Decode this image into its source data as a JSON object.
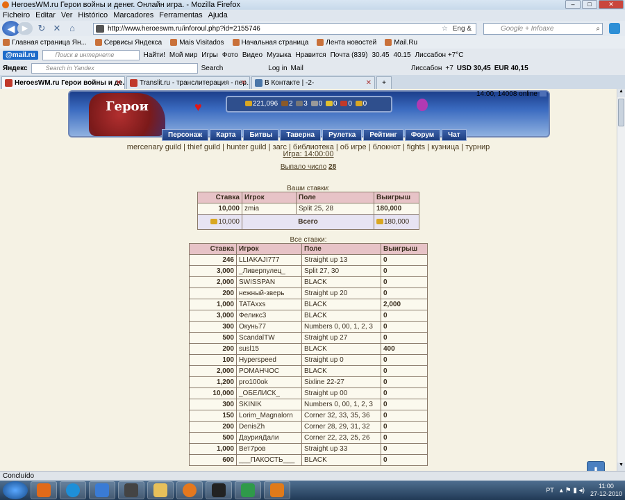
{
  "window": {
    "title": "HeroesWM.ru Герои войны и денег. Онлайн игра. - Mozilla Firefox"
  },
  "menubar": [
    "Ficheiro",
    "Editar",
    "Ver",
    "Histórico",
    "Marcadores",
    "Ferramentas",
    "Ajuda"
  ],
  "navbar": {
    "url": "http://www.heroeswm.ru/inforoul.php?id=2155746",
    "encoding": "Eng &",
    "search_placeholder": "Google + Infoaxe"
  },
  "bookmarks": [
    "Главная страница Ян...",
    "Сервисы Яндекса",
    "Mais Visitados",
    "Начальная страница",
    "Лента новостей",
    "Mail.Ru"
  ],
  "mailbar": {
    "logo": "@mail.ru",
    "search_placeholder": "Поиск в интернете",
    "find": "Найти!",
    "items": [
      "Мой мир",
      "Игры",
      "Фото",
      "Видео",
      "Музыка",
      "Нравится",
      "Почта (839)",
      "30.45",
      "40.15",
      "Лиссабон +7°C"
    ]
  },
  "yandexbar": {
    "logo": "Яндекс",
    "search_placeholder": "Search in Yandex",
    "search": "Search",
    "login": "Log in",
    "mail": "Mail",
    "city": "Лиссабон",
    "temp": "+7",
    "usd": "USD 30,45",
    "eur": "EUR 40,15"
  },
  "tabs": [
    {
      "label": "HeroesWM.ru Герои войны и де...",
      "active": true
    },
    {
      "label": "Translit.ru - транслитерация - пер...",
      "active": false
    },
    {
      "label": "В Контакте | -2-",
      "active": false
    }
  ],
  "game": {
    "resources": [
      "221,096",
      "2",
      "3",
      "0",
      "0",
      "0",
      "0"
    ],
    "time_online": "14:00, 14008 online",
    "menu": [
      "Персонаж",
      "Карта",
      "Битвы",
      "Таверна",
      "Рулетка",
      "Рейтинг",
      "Форум",
      "Чат"
    ],
    "links": "mercenary guild | thief guild | hunter guild | загс | библиотека | об игре | блокнот | fights | кузница | турнир",
    "game_time": "Игра: 14:00:00",
    "dropped_label": "Выпало число",
    "dropped_number": "28",
    "your_bets_caption": "Ваши ставки:",
    "all_bets_caption": "Все ставки:",
    "headers": [
      "Ставка",
      "Игрок",
      "Поле",
      "Выигрыш"
    ],
    "your_bets": [
      {
        "bet": "10,000",
        "player": "zmia",
        "field": "Split 25, 28",
        "win": "180,000"
      }
    ],
    "total": {
      "bet": "10,000",
      "label": "Всего",
      "win": "180,000"
    },
    "all_bets": [
      {
        "bet": "246",
        "player": "LLIAKAJI777",
        "field": "Straight up 13",
        "win": "0"
      },
      {
        "bet": "3,000",
        "player": "_Ливерпулец_",
        "field": "Split 27, 30",
        "win": "0"
      },
      {
        "bet": "2,000",
        "player": "SWISSPAN",
        "field": "BLACK",
        "win": "0"
      },
      {
        "bet": "200",
        "player": "нежный-зверь",
        "field": "Straight up 20",
        "win": "0"
      },
      {
        "bet": "1,000",
        "player": "TATAxxs",
        "field": "BLACK",
        "win": "2,000"
      },
      {
        "bet": "3,000",
        "player": "Феликс3",
        "field": "BLACK",
        "win": "0"
      },
      {
        "bet": "300",
        "player": "Окунь77",
        "field": "Numbers 0, 00, 1, 2, 3",
        "win": "0"
      },
      {
        "bet": "500",
        "player": "ScandalTW",
        "field": "Straight up 27",
        "win": "0"
      },
      {
        "bet": "200",
        "player": "susl15",
        "field": "BLACK",
        "win": "400"
      },
      {
        "bet": "100",
        "player": "Hyperspeed",
        "field": "Straight up 0",
        "win": "0"
      },
      {
        "bet": "2,000",
        "player": "РОМАНЧОС",
        "field": "BLACK",
        "win": "0"
      },
      {
        "bet": "1,200",
        "player": "pro100ok",
        "field": "Sixline 22-27",
        "win": "0"
      },
      {
        "bet": "10,000",
        "player": "_ОБЕЛИСК_",
        "field": "Straight up 00",
        "win": "0"
      },
      {
        "bet": "300",
        "player": "SKINIK",
        "field": "Numbers 0, 00, 1, 2, 3",
        "win": "0"
      },
      {
        "bet": "150",
        "player": "Lorim_Magnalorn",
        "field": "Corner 32, 33, 35, 36",
        "win": "0"
      },
      {
        "bet": "200",
        "player": "DenisZh",
        "field": "Corner 28, 29, 31, 32",
        "win": "0"
      },
      {
        "bet": "500",
        "player": "ДаурияДали",
        "field": "Corner 22, 23, 25, 26",
        "win": "0"
      },
      {
        "bet": "1,000",
        "player": "Вет7ров",
        "field": "Straight up 33",
        "win": "0"
      },
      {
        "bet": "600",
        "player": "___ПАКОСТЬ___",
        "field": "BLACK",
        "win": "0"
      }
    ]
  },
  "statusbar": "Concluído",
  "tray": {
    "lang": "PT",
    "time": "11:00",
    "date": "27-12-2010"
  }
}
